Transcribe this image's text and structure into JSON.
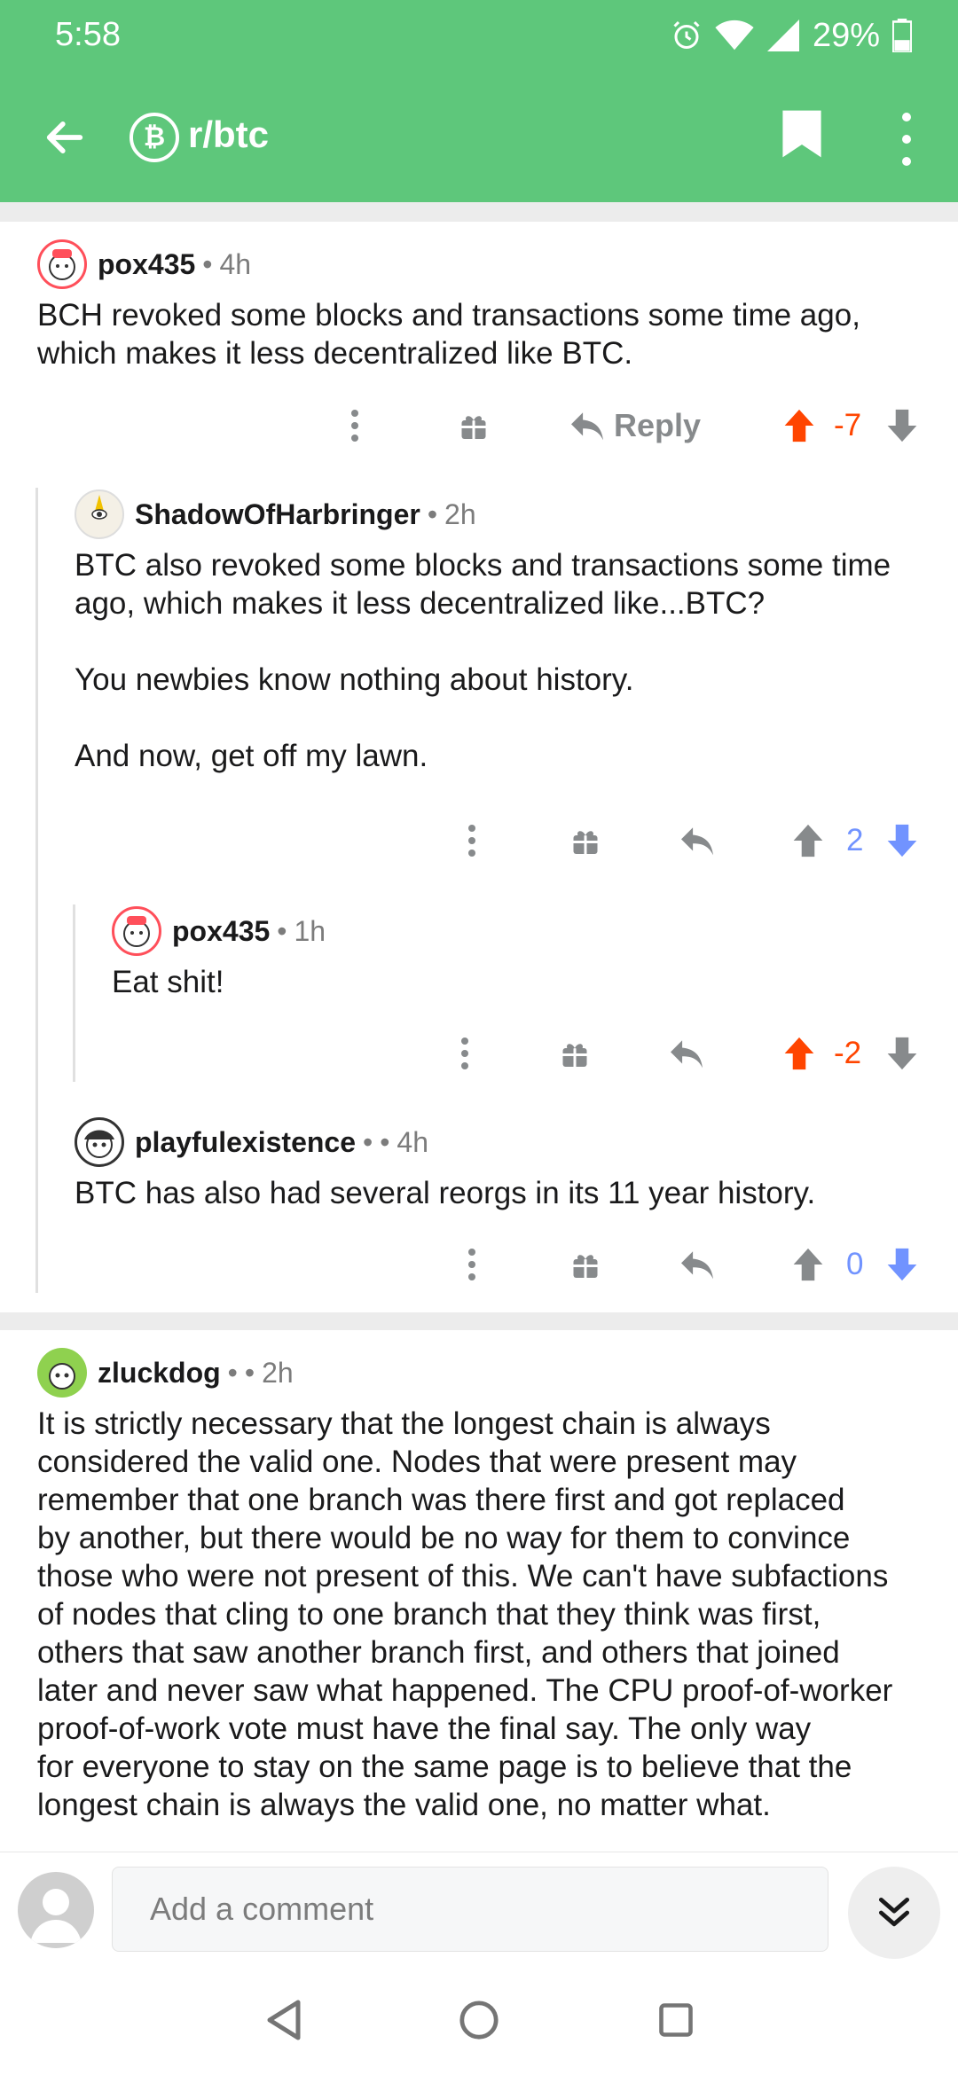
{
  "status_bar": {
    "time": "5:58",
    "battery": "29%"
  },
  "header": {
    "subreddit": "r/btc",
    "sub_icon_glyph": "₿",
    "back_icon": "arrow-left-icon",
    "bookmark_icon": "bookmark-icon",
    "more_icon": "more-vertical-icon"
  },
  "colors": {
    "header_bg": "#5ec77b",
    "upvote": "#ff4500",
    "downvote_blue": "#7193ff",
    "icon_gray": "#878a8c"
  },
  "comments": [
    {
      "author": "pox435",
      "age": "4h",
      "sep": "•",
      "body": "BCH revoked some blocks and transactions some time ago,\nwhich makes it less decentralized like BTC.",
      "reply_label": "Reply",
      "score": "-7",
      "vote_state": "upvoted"
    },
    {
      "author": "ShadowOfHarbringer",
      "age": "2h",
      "sep": "•",
      "body": "BTC also revoked some blocks and transactions some time\nago, which makes it less decentralized like...BTC?\n\nYou newbies know nothing about history.\n\nAnd now, get off my lawn.",
      "score": "2",
      "vote_state": "downvoted"
    },
    {
      "author": "pox435",
      "age": "1h",
      "sep": "•",
      "body": "Eat shit!",
      "score": "-2",
      "vote_state": "upvoted"
    },
    {
      "author": "playfulexistence",
      "age": "4h",
      "sep": "•",
      "sep2": "•",
      "body": "BTC has also had several reorgs in its 11 year history.",
      "score": "0",
      "vote_state": "downvoted"
    },
    {
      "author": "zluckdog",
      "age": "2h",
      "sep": "•",
      "sep2": "•",
      "body": "It is strictly necessary that the longest chain is always\nconsidered the valid one. Nodes that were present may\nremember that one branch was there first and got replaced\nby another, but there would be no way for them to convince\nthose who were not present of this. We can't have subfactions\nof nodes that cling to one branch that they think was first,\nothers that saw another branch first, and others that joined\nlater and never saw what happened. The CPU proof-of-worker\nproof-of-work vote must have the final say. The only way\nfor everyone to stay on the same page is to believe that the\nlongest chain is always the valid one, no matter what."
    }
  ],
  "comment_bar": {
    "placeholder": "Add a comment"
  },
  "nav": {
    "back": "nav-back-icon",
    "home": "nav-home-icon",
    "recents": "nav-recents-icon"
  }
}
